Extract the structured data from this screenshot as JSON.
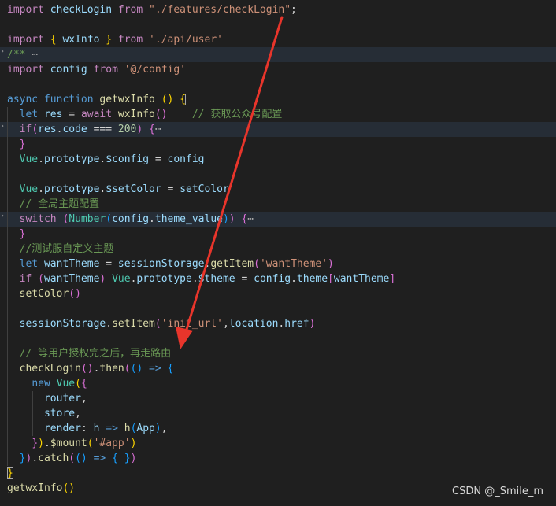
{
  "lines": [
    {
      "hl": false,
      "dot": false,
      "guides": [],
      "tokens": [
        {
          "t": "import ",
          "c": "ctl"
        },
        {
          "t": "checkLogin ",
          "c": "var"
        },
        {
          "t": "from ",
          "c": "ctl"
        },
        {
          "t": "\"./features/checkLogin\"",
          "c": "str"
        },
        {
          "t": ";",
          "c": "p"
        }
      ]
    },
    {
      "hl": false,
      "dot": false,
      "guides": [],
      "tokens": []
    },
    {
      "hl": false,
      "dot": false,
      "guides": [],
      "tokens": [
        {
          "t": "import ",
          "c": "ctl"
        },
        {
          "t": "{ ",
          "c": "b1"
        },
        {
          "t": "wxInfo ",
          "c": "var"
        },
        {
          "t": "} ",
          "c": "b1"
        },
        {
          "t": "from ",
          "c": "ctl"
        },
        {
          "t": "'./api/user'",
          "c": "str"
        }
      ]
    },
    {
      "hl": true,
      "dot": true,
      "guides": [],
      "tokens": [
        {
          "t": "/** ",
          "c": "cmt"
        },
        {
          "t": "⋯",
          "c": "fold"
        }
      ]
    },
    {
      "hl": false,
      "dot": false,
      "guides": [],
      "tokens": [
        {
          "t": "import ",
          "c": "ctl"
        },
        {
          "t": "config ",
          "c": "var"
        },
        {
          "t": "from ",
          "c": "ctl"
        },
        {
          "t": "'@/config'",
          "c": "str"
        }
      ]
    },
    {
      "hl": false,
      "dot": false,
      "guides": [],
      "tokens": []
    },
    {
      "hl": false,
      "dot": false,
      "guides": [],
      "tokens": [
        {
          "t": "async ",
          "c": "kw"
        },
        {
          "t": "function ",
          "c": "kw"
        },
        {
          "t": "getwxInfo ",
          "c": "fn"
        },
        {
          "t": "() ",
          "c": "b1"
        },
        {
          "t": "{",
          "c": "b1 box"
        }
      ]
    },
    {
      "hl": false,
      "dot": false,
      "guides": [
        9
      ],
      "tokens": [
        {
          "t": "  "
        },
        {
          "t": "let ",
          "c": "kw"
        },
        {
          "t": "res ",
          "c": "var"
        },
        {
          "t": "= ",
          "c": "op"
        },
        {
          "t": "await ",
          "c": "ctl"
        },
        {
          "t": "wxInfo",
          "c": "fn"
        },
        {
          "t": "()",
          "c": "b2"
        },
        {
          "t": "    "
        },
        {
          "t": "// 获取公众号配置",
          "c": "cmt"
        }
      ]
    },
    {
      "hl": true,
      "dot": true,
      "guides": [
        9
      ],
      "tokens": [
        {
          "t": "  "
        },
        {
          "t": "if",
          "c": "ctl"
        },
        {
          "t": "(",
          "c": "b2"
        },
        {
          "t": "res",
          "c": "var"
        },
        {
          "t": ".",
          "c": "p"
        },
        {
          "t": "code ",
          "c": "var"
        },
        {
          "t": "=== ",
          "c": "op"
        },
        {
          "t": "200",
          "c": "num"
        },
        {
          "t": ") ",
          "c": "b2"
        },
        {
          "t": "{",
          "c": "b2"
        },
        {
          "t": "⋯",
          "c": "fold"
        }
      ]
    },
    {
      "hl": false,
      "dot": false,
      "guides": [
        9
      ],
      "tokens": [
        {
          "t": "  "
        },
        {
          "t": "}",
          "c": "b2"
        }
      ]
    },
    {
      "hl": false,
      "dot": false,
      "guides": [
        9
      ],
      "tokens": [
        {
          "t": "  "
        },
        {
          "t": "Vue",
          "c": "ty"
        },
        {
          "t": ".",
          "c": "p"
        },
        {
          "t": "prototype",
          "c": "var"
        },
        {
          "t": ".",
          "c": "p"
        },
        {
          "t": "$config ",
          "c": "var"
        },
        {
          "t": "= ",
          "c": "op"
        },
        {
          "t": "config",
          "c": "var"
        }
      ]
    },
    {
      "hl": false,
      "dot": false,
      "guides": [
        9
      ],
      "tokens": []
    },
    {
      "hl": false,
      "dot": false,
      "guides": [
        9
      ],
      "tokens": [
        {
          "t": "  "
        },
        {
          "t": "Vue",
          "c": "ty"
        },
        {
          "t": ".",
          "c": "p"
        },
        {
          "t": "prototype",
          "c": "var"
        },
        {
          "t": ".",
          "c": "p"
        },
        {
          "t": "$setColor ",
          "c": "var"
        },
        {
          "t": "= ",
          "c": "op"
        },
        {
          "t": "setColor",
          "c": "var"
        }
      ]
    },
    {
      "hl": false,
      "dot": false,
      "guides": [
        9
      ],
      "tokens": [
        {
          "t": "  "
        },
        {
          "t": "// 全局主题配置",
          "c": "cmt"
        }
      ]
    },
    {
      "hl": true,
      "dot": true,
      "guides": [
        9
      ],
      "tokens": [
        {
          "t": "  "
        },
        {
          "t": "switch ",
          "c": "ctl"
        },
        {
          "t": "(",
          "c": "b2"
        },
        {
          "t": "Number",
          "c": "ty"
        },
        {
          "t": "(",
          "c": "b3"
        },
        {
          "t": "config",
          "c": "var"
        },
        {
          "t": ".",
          "c": "p"
        },
        {
          "t": "theme_value",
          "c": "var"
        },
        {
          "t": ")",
          "c": "b3"
        },
        {
          "t": ") ",
          "c": "b2"
        },
        {
          "t": "{",
          "c": "b2"
        },
        {
          "t": "⋯",
          "c": "fold"
        }
      ]
    },
    {
      "hl": false,
      "dot": false,
      "guides": [
        9
      ],
      "tokens": [
        {
          "t": "  "
        },
        {
          "t": "}",
          "c": "b2"
        }
      ]
    },
    {
      "hl": false,
      "dot": false,
      "guides": [
        9
      ],
      "tokens": [
        {
          "t": "  "
        },
        {
          "t": "//测试服自定义主题",
          "c": "cmt"
        }
      ]
    },
    {
      "hl": false,
      "dot": false,
      "guides": [
        9
      ],
      "tokens": [
        {
          "t": "  "
        },
        {
          "t": "let ",
          "c": "kw"
        },
        {
          "t": "wantTheme ",
          "c": "var"
        },
        {
          "t": "= ",
          "c": "op"
        },
        {
          "t": "sessionStorage",
          "c": "var"
        },
        {
          "t": ".",
          "c": "p"
        },
        {
          "t": "getItem",
          "c": "fn"
        },
        {
          "t": "(",
          "c": "b2"
        },
        {
          "t": "'wantTheme'",
          "c": "str"
        },
        {
          "t": ")",
          "c": "b2"
        }
      ]
    },
    {
      "hl": false,
      "dot": false,
      "guides": [
        9
      ],
      "tokens": [
        {
          "t": "  "
        },
        {
          "t": "if ",
          "c": "ctl"
        },
        {
          "t": "(",
          "c": "b2"
        },
        {
          "t": "wantTheme",
          "c": "var"
        },
        {
          "t": ") ",
          "c": "b2"
        },
        {
          "t": "Vue",
          "c": "ty"
        },
        {
          "t": ".",
          "c": "p"
        },
        {
          "t": "prototype",
          "c": "var"
        },
        {
          "t": ".",
          "c": "p"
        },
        {
          "t": "$theme ",
          "c": "var"
        },
        {
          "t": "= ",
          "c": "op"
        },
        {
          "t": "config",
          "c": "var"
        },
        {
          "t": ".",
          "c": "p"
        },
        {
          "t": "theme",
          "c": "var"
        },
        {
          "t": "[",
          "c": "b2"
        },
        {
          "t": "wantTheme",
          "c": "var"
        },
        {
          "t": "]",
          "c": "b2"
        }
      ]
    },
    {
      "hl": false,
      "dot": false,
      "guides": [
        9
      ],
      "tokens": [
        {
          "t": "  "
        },
        {
          "t": "setColor",
          "c": "fn"
        },
        {
          "t": "()",
          "c": "b2"
        }
      ]
    },
    {
      "hl": false,
      "dot": false,
      "guides": [
        9
      ],
      "tokens": []
    },
    {
      "hl": false,
      "dot": false,
      "guides": [
        9
      ],
      "tokens": [
        {
          "t": "  "
        },
        {
          "t": "sessionStorage",
          "c": "var"
        },
        {
          "t": ".",
          "c": "p"
        },
        {
          "t": "setItem",
          "c": "fn"
        },
        {
          "t": "(",
          "c": "b2"
        },
        {
          "t": "'init_url'",
          "c": "str"
        },
        {
          "t": ",",
          "c": "p"
        },
        {
          "t": "location",
          "c": "var"
        },
        {
          "t": ".",
          "c": "p"
        },
        {
          "t": "href",
          "c": "var"
        },
        {
          "t": ")",
          "c": "b2"
        }
      ]
    },
    {
      "hl": false,
      "dot": false,
      "guides": [
        9
      ],
      "tokens": []
    },
    {
      "hl": false,
      "dot": false,
      "guides": [
        9
      ],
      "tokens": [
        {
          "t": "  "
        },
        {
          "t": "// 等用户授权完之后，再走路由",
          "c": "cmt"
        }
      ]
    },
    {
      "hl": false,
      "dot": false,
      "guides": [
        9
      ],
      "tokens": [
        {
          "t": "  "
        },
        {
          "t": "checkLogin",
          "c": "fn"
        },
        {
          "t": "()",
          "c": "b2"
        },
        {
          "t": ".",
          "c": "p"
        },
        {
          "t": "then",
          "c": "fn"
        },
        {
          "t": "(",
          "c": "b2"
        },
        {
          "t": "()",
          "c": "b3"
        },
        {
          "t": " => ",
          "c": "kw"
        },
        {
          "t": "{",
          "c": "b3"
        }
      ]
    },
    {
      "hl": false,
      "dot": false,
      "guides": [
        9,
        25
      ],
      "tokens": [
        {
          "t": "    "
        },
        {
          "t": "new ",
          "c": "kw"
        },
        {
          "t": "Vue",
          "c": "ty"
        },
        {
          "t": "(",
          "c": "b1"
        },
        {
          "t": "{",
          "c": "b2"
        }
      ]
    },
    {
      "hl": false,
      "dot": false,
      "guides": [
        9,
        25,
        41
      ],
      "tokens": [
        {
          "t": "      "
        },
        {
          "t": "router",
          "c": "var"
        },
        {
          "t": ",",
          "c": "p"
        }
      ]
    },
    {
      "hl": false,
      "dot": false,
      "guides": [
        9,
        25,
        41
      ],
      "tokens": [
        {
          "t": "      "
        },
        {
          "t": "store",
          "c": "var"
        },
        {
          "t": ",",
          "c": "p"
        }
      ]
    },
    {
      "hl": false,
      "dot": false,
      "guides": [
        9,
        25,
        41
      ],
      "tokens": [
        {
          "t": "      "
        },
        {
          "t": "render",
          "c": "var"
        },
        {
          "t": ": ",
          "c": "p"
        },
        {
          "t": "h",
          "c": "var"
        },
        {
          "t": " => ",
          "c": "kw"
        },
        {
          "t": "h",
          "c": "fn"
        },
        {
          "t": "(",
          "c": "b3"
        },
        {
          "t": "App",
          "c": "var"
        },
        {
          "t": ")",
          "c": "b3"
        },
        {
          "t": ",",
          "c": "p"
        }
      ]
    },
    {
      "hl": false,
      "dot": false,
      "guides": [
        9,
        25
      ],
      "tokens": [
        {
          "t": "    "
        },
        {
          "t": "}",
          "c": "b2"
        },
        {
          "t": ")",
          "c": "b1"
        },
        {
          "t": ".",
          "c": "p"
        },
        {
          "t": "$mount",
          "c": "fn"
        },
        {
          "t": "(",
          "c": "b1"
        },
        {
          "t": "'#app'",
          "c": "str"
        },
        {
          "t": ")",
          "c": "b1"
        }
      ]
    },
    {
      "hl": false,
      "dot": false,
      "guides": [
        9
      ],
      "tokens": [
        {
          "t": "  "
        },
        {
          "t": "}",
          "c": "b3"
        },
        {
          "t": ")",
          "c": "b2"
        },
        {
          "t": ".",
          "c": "p"
        },
        {
          "t": "catch",
          "c": "fn"
        },
        {
          "t": "(",
          "c": "b2"
        },
        {
          "t": "()",
          "c": "b3"
        },
        {
          "t": " => ",
          "c": "kw"
        },
        {
          "t": "{ }",
          "c": "b3"
        },
        {
          "t": ")",
          "c": "b2"
        }
      ]
    },
    {
      "hl": false,
      "dot": false,
      "guides": [],
      "tokens": [
        {
          "t": "}",
          "c": "b1 box"
        }
      ]
    },
    {
      "hl": false,
      "dot": false,
      "guides": [],
      "tokens": [
        {
          "t": "getwxInfo",
          "c": "fn"
        },
        {
          "t": "()",
          "c": "b1"
        }
      ]
    }
  ],
  "watermark": "CSDN @_Smile_m",
  "colors": {
    "background": "#1f1f1f",
    "arrow": "#e8352b"
  }
}
